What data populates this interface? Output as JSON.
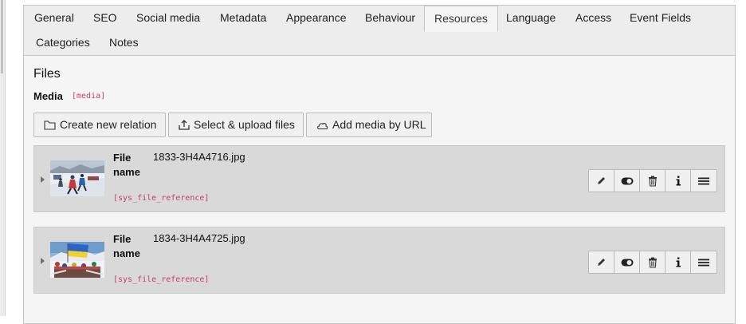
{
  "tabs": [
    {
      "label": "General"
    },
    {
      "label": "SEO"
    },
    {
      "label": "Social media"
    },
    {
      "label": "Metadata"
    },
    {
      "label": "Appearance"
    },
    {
      "label": "Behaviour"
    },
    {
      "label": "Resources"
    },
    {
      "label": "Language"
    },
    {
      "label": "Access"
    },
    {
      "label": "Event Fields"
    },
    {
      "label": "Categories"
    },
    {
      "label": "Notes"
    }
  ],
  "active_tab": "Resources",
  "section": {
    "title": "Files"
  },
  "field": {
    "label": "Media",
    "name": "[media]"
  },
  "buttons": {
    "create": "Create new relation",
    "upload": "Select & upload files",
    "url": "Add media by URL"
  },
  "records": [
    {
      "label": "File name",
      "filename": "1833-3H4A4716.jpg",
      "table": "[sys_file_reference]"
    },
    {
      "label": "File name",
      "filename": "1834-3H4A4725.jpg",
      "table": "[sys_file_reference]"
    }
  ],
  "colors": {
    "accent": "#c83c6a",
    "record_bg": "#d9d9d9",
    "panel_bg": "#f5f5f5"
  }
}
